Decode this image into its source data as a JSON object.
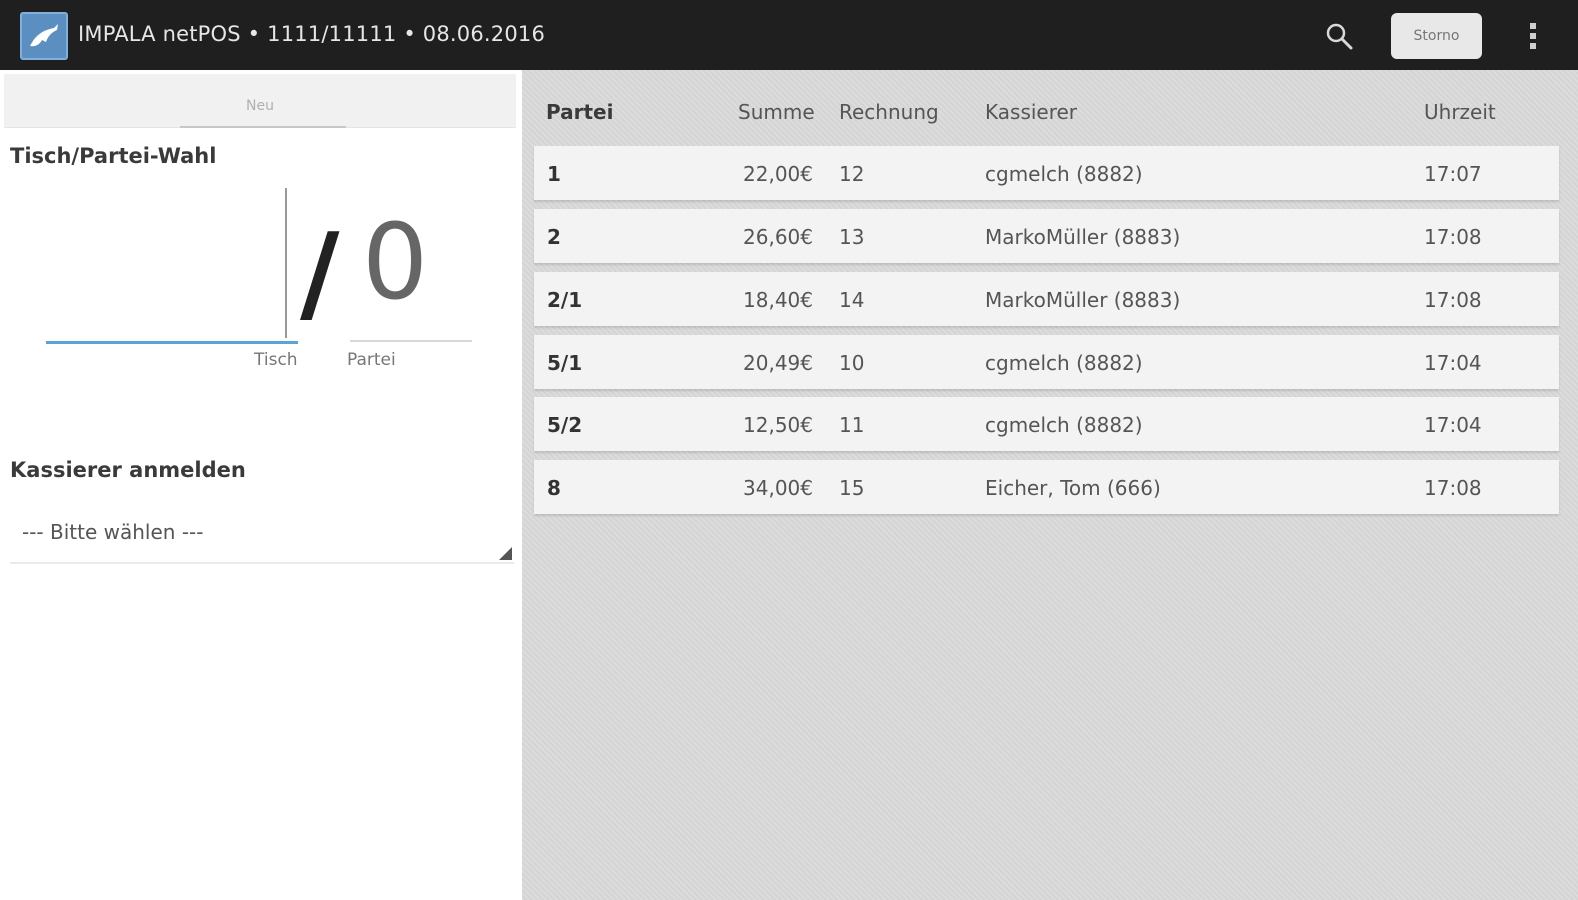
{
  "header": {
    "title": "IMPALA netPOS • 1111/11111 • 08.06.2016",
    "storno_label": "Storno"
  },
  "left": {
    "tab_label": "Neu",
    "section_title": "Tisch/Partei-Wahl",
    "separator": "/",
    "partei_value": "0",
    "tisch_label": "Tisch",
    "partei_label": "Partei",
    "kassierer_title": "Kassierer anmelden",
    "kassierer_placeholder": "--- Bitte wählen ---"
  },
  "table": {
    "columns": [
      "Partei",
      "Summe",
      "Rechnung",
      "Kassierer",
      "Uhrzeit"
    ],
    "rows": [
      {
        "partei": "1",
        "summe": "22,00€",
        "rechnung": "12",
        "kassierer": "cgmelch (8882)",
        "uhrzeit": "17:07"
      },
      {
        "partei": "2",
        "summe": "26,60€",
        "rechnung": "13",
        "kassierer": "MarkoMüller (8883)",
        "uhrzeit": "17:08"
      },
      {
        "partei": "2/1",
        "summe": "18,40€",
        "rechnung": "14",
        "kassierer": "MarkoMüller (8883)",
        "uhrzeit": "17:08"
      },
      {
        "partei": "5/1",
        "summe": "20,49€",
        "rechnung": "10",
        "kassierer": "cgmelch (8882)",
        "uhrzeit": "17:04"
      },
      {
        "partei": "5/2",
        "summe": "12,50€",
        "rechnung": "11",
        "kassierer": "cgmelch (8882)",
        "uhrzeit": "17:04"
      },
      {
        "partei": "8",
        "summe": "34,00€",
        "rechnung": "15",
        "kassierer": "Eicher, Tom (666)",
        "uhrzeit": "17:08"
      }
    ]
  },
  "icons": {
    "app": "impala-logo-icon",
    "search": "search-icon",
    "overflow": "overflow-menu-icon",
    "dropdown": "dropdown-triangle-icon"
  },
  "colors": {
    "topbar": "#1f1f1f",
    "accent": "#5aa3d8",
    "app_icon": "#5b8fc1"
  }
}
